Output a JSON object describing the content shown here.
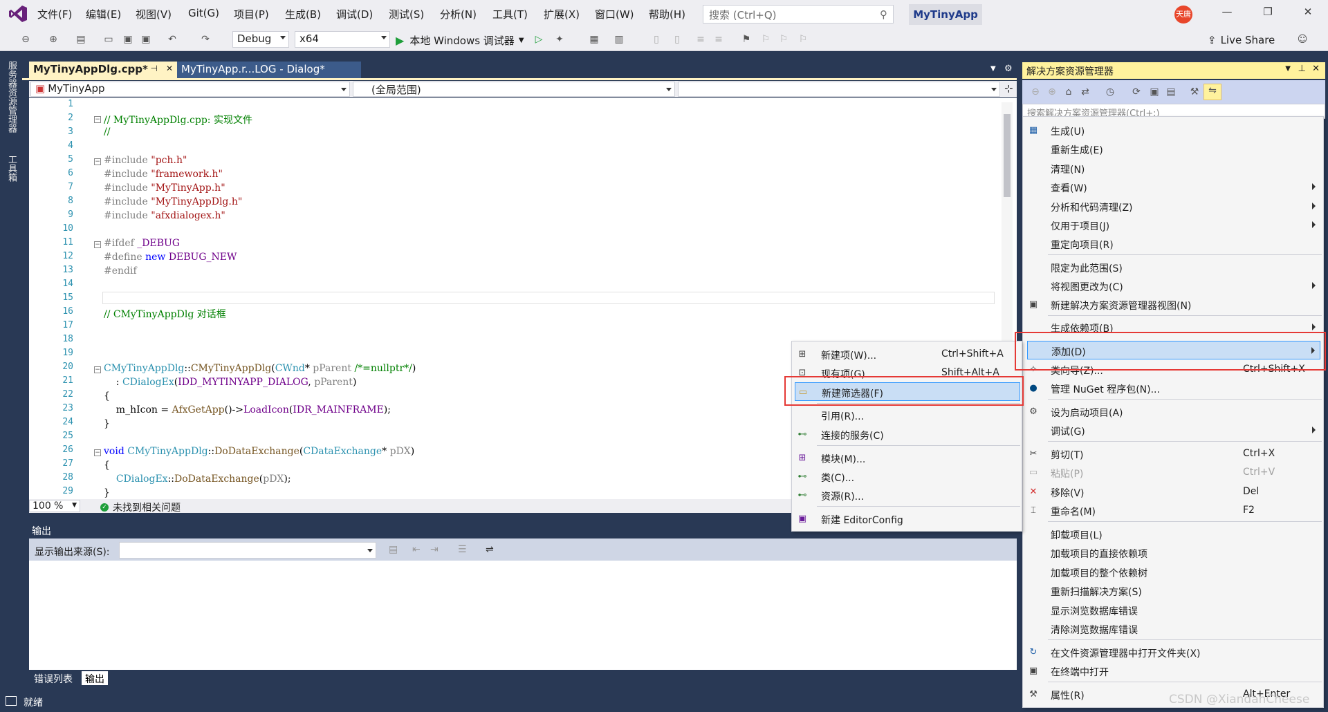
{
  "menubar": {
    "items": [
      "文件(F)",
      "编辑(E)",
      "视图(V)",
      "Git(G)",
      "项目(P)",
      "生成(B)",
      "调试(D)",
      "测试(S)",
      "分析(N)",
      "工具(T)",
      "扩展(X)",
      "窗口(W)",
      "帮助(H)"
    ],
    "search_placeholder": "搜索 (Ctrl+Q)",
    "app_title": "MyTinyApp",
    "avatar_text": "天唐"
  },
  "toolbar": {
    "config": "Debug",
    "platform": "x64",
    "run_label": "本地 Windows 调试器",
    "live_share": "Live Share"
  },
  "left_strip": {
    "tab1": "服务器资源管理器",
    "tab2": "工具箱"
  },
  "editor": {
    "tabs": [
      {
        "label": "MyTinyAppDlg.cpp*",
        "pin": "⊣",
        "close": "✕"
      },
      {
        "label": "MyTinyApp.r...LOG - Dialog*"
      }
    ],
    "nav_project": "MyTinyApp",
    "nav_scope": "(全局范围)",
    "zoom": "100 %",
    "issues": "未找到相关问题",
    "line_numbers": [
      "1",
      "2",
      "3",
      "4",
      "5",
      "6",
      "7",
      "8",
      "9",
      "10",
      "11",
      "12",
      "13",
      "14",
      "15",
      "16",
      "17",
      "18",
      "19",
      "20",
      "21",
      "22",
      "23",
      "24",
      "25",
      "26",
      "27",
      "28",
      "29"
    ]
  },
  "output": {
    "title": "输出",
    "source_label": "显示输出来源(S):",
    "tabs": [
      "错误列表",
      "输出"
    ]
  },
  "statusbar": {
    "text": "就绪"
  },
  "solution_explorer": {
    "title": "解决方案资源管理器",
    "search_placeholder": "搜索解决方案资源管理器(Ctrl+;)"
  },
  "project_menu": {
    "items": [
      {
        "label": "生成(U)",
        "icon": "build-icon"
      },
      {
        "label": "重新生成(E)"
      },
      {
        "label": "清理(N)"
      },
      {
        "label": "查看(W)",
        "submenu": true
      },
      {
        "label": "分析和代码清理(Z)",
        "submenu": true
      },
      {
        "label": "仅用于项目(J)",
        "submenu": true
      },
      {
        "label": "重定向项目(R)"
      },
      {
        "label": "限定为此范围(S)"
      },
      {
        "label": "将视图更改为(C)",
        "submenu": true
      },
      {
        "label": "新建解决方案资源管理器视图(N)",
        "icon": "new-view-icon"
      },
      {
        "label": "生成依赖项(B)",
        "submenu": true
      },
      {
        "label": "添加(D)",
        "submenu": true,
        "highlighted": true
      },
      {
        "label": "类向导(Z)...",
        "shortcut": "Ctrl+Shift+X",
        "icon": "class-wizard-icon"
      },
      {
        "label": "管理 NuGet 程序包(N)...",
        "icon": "nuget-icon"
      },
      {
        "label": "设为启动项目(A)",
        "icon": "gear-icon"
      },
      {
        "label": "调试(G)",
        "submenu": true
      },
      {
        "label": "剪切(T)",
        "shortcut": "Ctrl+X",
        "icon": "cut-icon"
      },
      {
        "label": "粘贴(P)",
        "shortcut": "Ctrl+V",
        "icon": "paste-icon",
        "disabled": true
      },
      {
        "label": "移除(V)",
        "shortcut": "Del",
        "icon": "remove-icon"
      },
      {
        "label": "重命名(M)",
        "shortcut": "F2",
        "icon": "rename-icon"
      },
      {
        "label": "卸载项目(L)"
      },
      {
        "label": "加载项目的直接依赖项"
      },
      {
        "label": "加载项目的整个依赖树"
      },
      {
        "label": "重新扫描解决方案(S)"
      },
      {
        "label": "显示浏览数据库错误"
      },
      {
        "label": "清除浏览数据库错误"
      },
      {
        "label": "在文件资源管理器中打开文件夹(X)",
        "icon": "open-folder-icon"
      },
      {
        "label": "在终端中打开",
        "icon": "terminal-icon"
      },
      {
        "label": "属性(R)",
        "shortcut": "Alt+Enter",
        "icon": "wrench-icon"
      }
    ]
  },
  "add_menu": {
    "items": [
      {
        "label": "新建项(W)...",
        "shortcut": "Ctrl+Shift+A",
        "icon": "new-item-icon"
      },
      {
        "label": "现有项(G)...",
        "shortcut": "Shift+Alt+A",
        "icon": "existing-item-icon"
      },
      {
        "label": "新建筛选器(F)",
        "icon": "new-filter-icon",
        "highlighted": true
      },
      {
        "label": "引用(R)..."
      },
      {
        "label": "连接的服务(C)",
        "icon": "connected-service-icon"
      },
      {
        "label": "模块(M)...",
        "icon": "module-icon"
      },
      {
        "label": "类(C)...",
        "icon": "class-icon"
      },
      {
        "label": "资源(R)...",
        "icon": "resource-icon"
      },
      {
        "label": "新建 EditorConfig",
        "icon": "editorconfig-icon"
      }
    ]
  },
  "watermark": "CSDN @XiandanCheese"
}
